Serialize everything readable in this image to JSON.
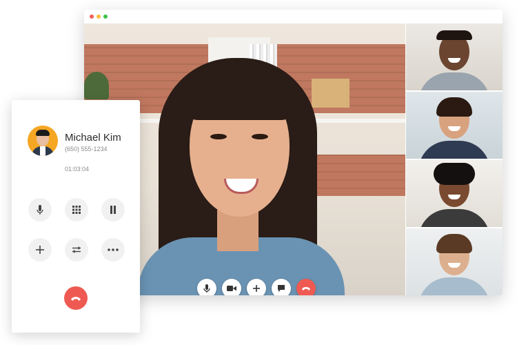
{
  "dialer": {
    "caller_name": "Michael Kim",
    "caller_number": "(650) 555-1234",
    "call_duration": "01:03:04",
    "buttons": [
      "mute",
      "keypad",
      "hold",
      "add-call",
      "transfer",
      "more"
    ],
    "hangup": "end-call"
  },
  "video_call": {
    "controls": [
      "microphone",
      "camera",
      "add",
      "chat",
      "end-call"
    ],
    "participants_count_thumbnails": 4
  },
  "colors": {
    "end_call": "#ee5a52",
    "avatar_bg": "#f5a623",
    "window_dot_red": "#f25f58",
    "window_dot_yellow": "#fbbe3f",
    "window_dot_green": "#3bc346"
  },
  "icons": {
    "mute": "microphone-icon",
    "keypad": "keypad-grid-icon",
    "hold": "pause-icon",
    "add_call": "plus-icon",
    "transfer": "transfer-arrows-icon",
    "more": "more-dots-icon",
    "hangup": "phone-hangup-icon",
    "camera": "video-camera-icon",
    "chat": "chat-bubble-icon"
  }
}
